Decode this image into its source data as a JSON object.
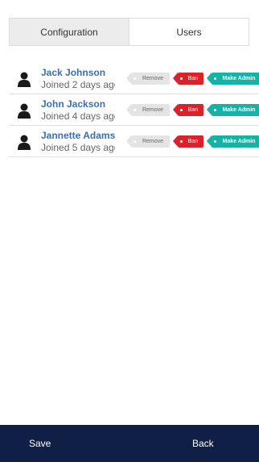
{
  "tabs": [
    {
      "label": "Configuration",
      "active": true
    },
    {
      "label": "Users",
      "active": false
    }
  ],
  "users": [
    {
      "name": "Jack Johnson",
      "joined": "Joined 2 days ago"
    },
    {
      "name": "John Jackson",
      "joined": "Joined 4 days ago"
    },
    {
      "name": "Jannette Adams",
      "joined": "Joined 5 days ago"
    }
  ],
  "actions": {
    "remove_label": "Remove",
    "ban_label": "Ban",
    "make_admin_label": "Make Admin"
  },
  "footer": {
    "save_label": "Save",
    "back_label": "Back"
  },
  "colors": {
    "name_link": "#3a6fb0",
    "ban": "#d9222a",
    "make_admin": "#14b3a6",
    "remove": "#e4e4e4",
    "footer_bg": "#0f1f45"
  },
  "icons": {
    "avatar": "person-icon"
  }
}
